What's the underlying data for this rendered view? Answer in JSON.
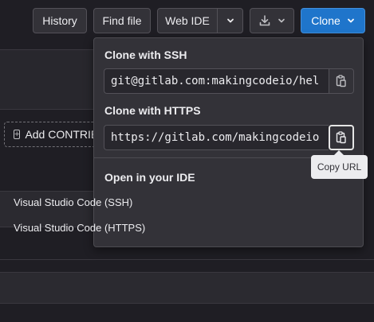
{
  "toolbar": {
    "history_label": "History",
    "find_file_label": "Find file",
    "web_ide_label": "Web IDE",
    "clone_label": "Clone"
  },
  "background": {
    "add_contributing_label": "Add CONTRIBUTING"
  },
  "clone_dropdown": {
    "ssh_heading": "Clone with SSH",
    "ssh_url": "git@gitlab.com:makingcodeio/hel",
    "https_heading": "Clone with HTTPS",
    "https_url": "https://gitlab.com/makingcodeio",
    "ide_heading": "Open in your IDE",
    "ide_items": [
      {
        "label": "Visual Studio Code (SSH)"
      },
      {
        "label": "Visual Studio Code (HTTPS)"
      }
    ]
  },
  "tooltip": {
    "text": "Copy URL"
  },
  "icons": {
    "copy": "clipboard-icon",
    "caret": "chevron-down-icon",
    "download": "download-icon",
    "add": "plus-square-icon"
  },
  "colors": {
    "accent": "#1f75cb",
    "background": "#1f1e24",
    "surface": "#333238"
  }
}
